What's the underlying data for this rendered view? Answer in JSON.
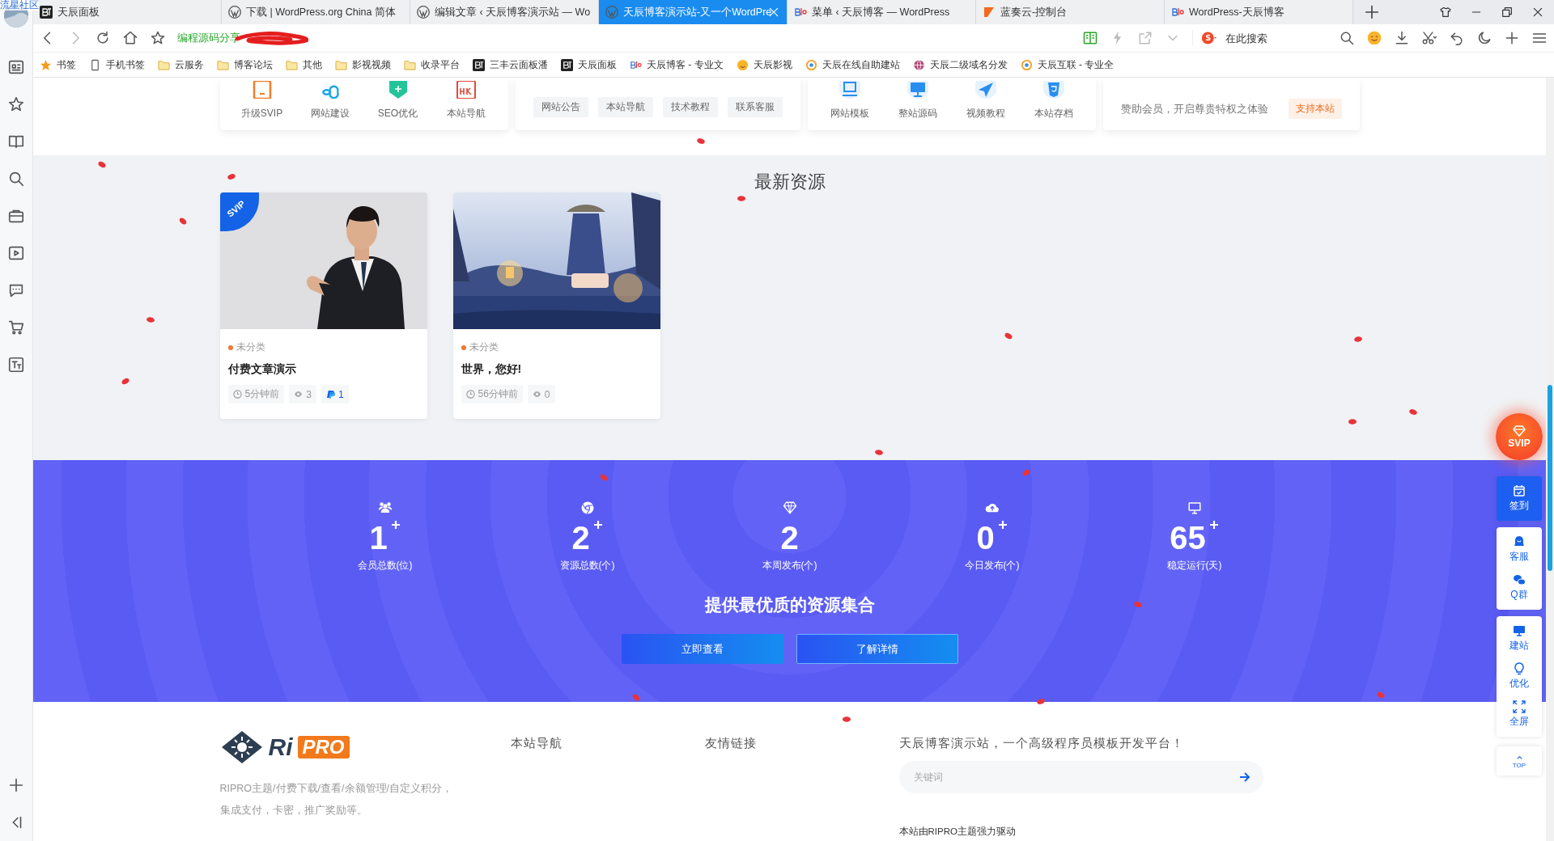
{
  "browser": {
    "profile_label": "流星社区",
    "tabs": [
      {
        "title": "天辰面板",
        "kind": "bt",
        "selected": false
      },
      {
        "title": "下载 | WordPress.org China 简体",
        "kind": "wordpress",
        "selected": false
      },
      {
        "title": "编辑文章 ‹ 天辰博客演示站 — Wo",
        "kind": "wordpress",
        "selected": false
      },
      {
        "title": "天辰博客演示站-又一个WordPre",
        "kind": "wordpress",
        "selected": true
      },
      {
        "title": "菜单 ‹ 天辰博客 — WordPress",
        "kind": "blog",
        "selected": false
      },
      {
        "title": "蓝奏云-控制台",
        "kind": "lanzou",
        "selected": false
      },
      {
        "title": "WordPress-天辰博客",
        "kind": "blog",
        "selected": false
      }
    ],
    "address_bar": {
      "text": "编程源码分享",
      "redacted": true
    },
    "search_box": {
      "placeholder": "在此搜索"
    },
    "bookmarks": [
      {
        "label": "书签",
        "kind": "star"
      },
      {
        "label": "手机书签",
        "kind": "phone"
      },
      {
        "label": "云服务",
        "kind": "folder"
      },
      {
        "label": "博客论坛",
        "kind": "folder"
      },
      {
        "label": "其他",
        "kind": "folder"
      },
      {
        "label": "影视视频",
        "kind": "folder"
      },
      {
        "label": "收录平台",
        "kind": "folder"
      },
      {
        "label": "三丰云面板潘",
        "kind": "bt"
      },
      {
        "label": "天辰面板",
        "kind": "bt"
      },
      {
        "label": "天辰博客 - 专业文",
        "kind": "blog"
      },
      {
        "label": "天辰影视",
        "kind": "smile"
      },
      {
        "label": "天辰在线自助建站",
        "kind": "site"
      },
      {
        "label": "天辰二级域名分发",
        "kind": "globe"
      },
      {
        "label": "天辰互联 - 专业全",
        "kind": "site"
      }
    ]
  },
  "top_cards": [
    {
      "kind": "icons",
      "items": [
        "升级SVIP",
        "网站建设",
        "SEO优化",
        "本站导航"
      ]
    },
    {
      "kind": "tags",
      "items": [
        "网站公告",
        "本站导航",
        "技术教程",
        "联系客服"
      ]
    },
    {
      "kind": "icons",
      "items": [
        "网站模板",
        "整站源码",
        "视频教程",
        "本站存档"
      ]
    },
    {
      "kind": "promo",
      "text": "赞助会员，开启尊贵特权之体验",
      "tag": "支持本站"
    }
  ],
  "latest": {
    "heading": "最新资源",
    "posts": [
      {
        "badge": "SVIP",
        "category": "未分类",
        "title": "付费文章演示",
        "time": "5分钟前",
        "views": "3",
        "price": "1"
      },
      {
        "category": "未分类",
        "title": "世界，您好!",
        "time": "56分钟前",
        "views": "0"
      }
    ]
  },
  "stats": {
    "items": [
      {
        "value": "1",
        "plus": true,
        "label": "会员总数(位)"
      },
      {
        "value": "2",
        "plus": true,
        "label": "资源总数(个)"
      },
      {
        "value": "2",
        "plus": false,
        "label": "本周发布(个)"
      },
      {
        "value": "0",
        "plus": true,
        "label": "今日发布(个)"
      },
      {
        "value": "65",
        "plus": true,
        "label": "稳定运行(天)"
      }
    ],
    "title": "提供最优质的资源集合",
    "buttons": [
      {
        "label": "立即查看",
        "kind": "filled"
      },
      {
        "label": "了解详情",
        "kind": "outlined"
      }
    ]
  },
  "footer": {
    "logo": {
      "text": "Ri",
      "badge": "PRO"
    },
    "description": "RIPRO主题/付费下载/查看/余额管理/自定义积分，集成支付，卡密，推广奖励等。",
    "columns": [
      "本站导航",
      "友情链接"
    ],
    "tagline": "天辰博客演示站，一个高级程序员模板开发平台！",
    "search": {
      "placeholder": "关键词"
    },
    "powered_by": "本站由RIPRO主题强力驱动"
  },
  "float_bar": {
    "svip": "SVIP",
    "groups": [
      [
        {
          "label": "签到",
          "selected": true
        }
      ],
      [
        {
          "label": "客服",
          "selected": false
        },
        {
          "label": "Q群",
          "selected": false
        }
      ],
      [
        {
          "label": "建站",
          "selected": false
        },
        {
          "label": "优化",
          "selected": false
        },
        {
          "label": "全屏",
          "selected": false
        }
      ]
    ],
    "top": "TOP"
  }
}
